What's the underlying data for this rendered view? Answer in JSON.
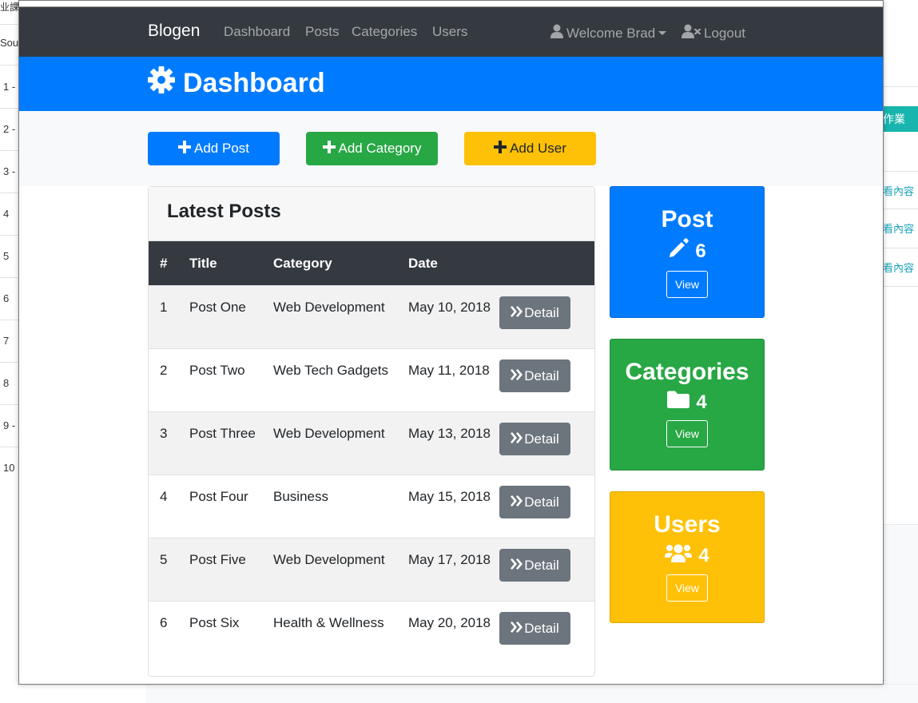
{
  "background": {
    "top_cut_text": "业課",
    "source_cut_text": "Source",
    "row_numbers": [
      "1 -",
      "2 -",
      "3 -",
      "4",
      "5",
      "6",
      "7",
      "8",
      "9 -",
      "10"
    ],
    "right_button": "作業",
    "right_links": [
      "看內容",
      "看內容",
      "看內容"
    ]
  },
  "navbar": {
    "brand": "Blogen",
    "links": [
      "Dashboard",
      "Posts",
      "Categories",
      "Users"
    ],
    "welcome": "Welcome Brad",
    "logout": "Logout"
  },
  "header": {
    "title": "Dashboard"
  },
  "actions": {
    "add_post": "Add Post",
    "add_category": "Add Category",
    "add_user": "Add User"
  },
  "latest_posts": {
    "title": "Latest Posts",
    "columns": [
      "#",
      "Title",
      "Category",
      "Date"
    ],
    "detail_label": "Detail",
    "rows": [
      {
        "num": "1",
        "title": "Post One",
        "category": "Web Development",
        "date": "May 10, 2018"
      },
      {
        "num": "2",
        "title": "Post Two",
        "category": "Web Tech Gadgets",
        "date": "May 11, 2018"
      },
      {
        "num": "3",
        "title": "Post Three",
        "category": "Web Development",
        "date": "May 13, 2018"
      },
      {
        "num": "4",
        "title": "Post Four",
        "category": "Business",
        "date": "May 15, 2018"
      },
      {
        "num": "5",
        "title": "Post Five",
        "category": "Web Development",
        "date": "May 17, 2018"
      },
      {
        "num": "6",
        "title": "Post Six",
        "category": "Health & Wellness",
        "date": "May 20, 2018"
      }
    ]
  },
  "stats": {
    "posts": {
      "title": "Post",
      "count": "6",
      "icon": "pencil-icon",
      "view": "View",
      "color": "#007bff"
    },
    "categories": {
      "title": "Categories",
      "count": "4",
      "icon": "folder-icon",
      "view": "View",
      "color": "#28a745"
    },
    "users": {
      "title": "Users",
      "count": "4",
      "icon": "users-icon",
      "view": "View",
      "color": "#ffc107"
    }
  },
  "colors": {
    "navbar": "#343a40",
    "primary": "#007bff",
    "success": "#28a745",
    "warning": "#ffc107",
    "secondary": "#6c757d"
  }
}
